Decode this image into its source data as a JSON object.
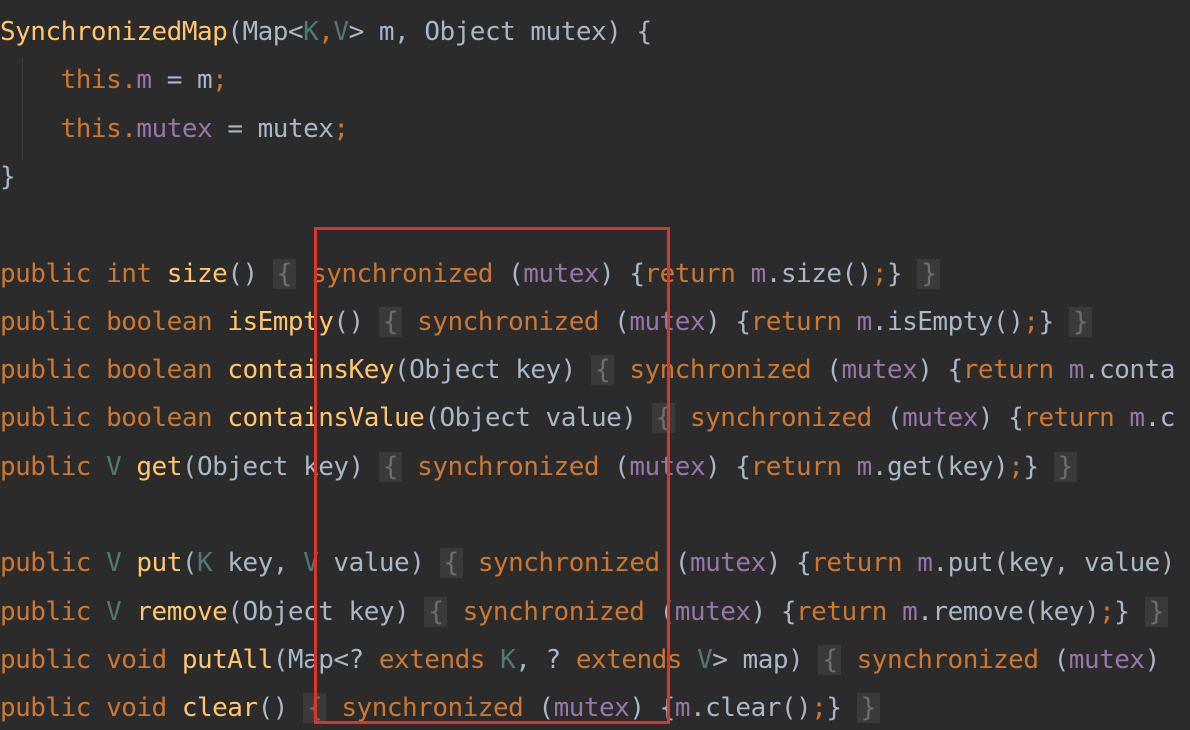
{
  "editor": {
    "theme_colors": {
      "background": "#2b2b2b",
      "keyword": "#cc7832",
      "method": "#ffc66d",
      "field": "#9876aa",
      "type_param": "#507874",
      "plain": "#a9b7c6",
      "highlight_border": "#d9352e"
    },
    "lines": [
      {
        "tokens": [
          {
            "t": "SynchronizedMap",
            "c": "fn"
          },
          {
            "t": "(",
            "c": "pl"
          },
          {
            "t": "Map<",
            "c": "pl"
          },
          {
            "t": "K",
            "c": "tp"
          },
          {
            "t": ",",
            "c": "pu"
          },
          {
            "t": "V",
            "c": "tp"
          },
          {
            "t": "> m, Object mutex) {",
            "c": "pl"
          }
        ]
      },
      {
        "tokens": [
          {
            "t": "    this",
            "c": "kw"
          },
          {
            "t": ".",
            "c": "pu"
          },
          {
            "t": "m",
            "c": "fld"
          },
          {
            "t": " = m",
            "c": "pl"
          },
          {
            "t": ";",
            "c": "pu"
          }
        ]
      },
      {
        "tokens": [
          {
            "t": "    this",
            "c": "kw"
          },
          {
            "t": ".",
            "c": "pu"
          },
          {
            "t": "mutex",
            "c": "fld"
          },
          {
            "t": " = mutex",
            "c": "pl"
          },
          {
            "t": ";",
            "c": "pu"
          }
        ]
      },
      {
        "tokens": [
          {
            "t": "}",
            "c": "pl"
          }
        ]
      },
      {
        "tokens": []
      },
      {
        "tokens": [
          {
            "t": "public int ",
            "c": "kw"
          },
          {
            "t": "size",
            "c": "fn"
          },
          {
            "t": "() ",
            "c": "pl"
          },
          {
            "t": "{",
            "c": "fold"
          },
          {
            "t": " ",
            "c": "pl"
          },
          {
            "t": "synchronized",
            "c": "kw"
          },
          {
            "t": " (",
            "c": "pl"
          },
          {
            "t": "mutex",
            "c": "fld"
          },
          {
            "t": ") {",
            "c": "pl"
          },
          {
            "t": "return ",
            "c": "kw"
          },
          {
            "t": "m",
            "c": "fld"
          },
          {
            "t": ".size()",
            "c": "pl"
          },
          {
            "t": ";",
            "c": "pu"
          },
          {
            "t": "} ",
            "c": "pl"
          },
          {
            "t": "}",
            "c": "fold"
          }
        ]
      },
      {
        "tokens": [
          {
            "t": "public boolean ",
            "c": "kw"
          },
          {
            "t": "isEmpty",
            "c": "fn"
          },
          {
            "t": "() ",
            "c": "pl"
          },
          {
            "t": "{",
            "c": "fold"
          },
          {
            "t": " ",
            "c": "pl"
          },
          {
            "t": "synchronized",
            "c": "kw"
          },
          {
            "t": " (",
            "c": "pl"
          },
          {
            "t": "mutex",
            "c": "fld"
          },
          {
            "t": ") {",
            "c": "pl"
          },
          {
            "t": "return ",
            "c": "kw"
          },
          {
            "t": "m",
            "c": "fld"
          },
          {
            "t": ".isEmpty()",
            "c": "pl"
          },
          {
            "t": ";",
            "c": "pu"
          },
          {
            "t": "} ",
            "c": "pl"
          },
          {
            "t": "}",
            "c": "fold"
          }
        ]
      },
      {
        "tokens": [
          {
            "t": "public boolean ",
            "c": "kw"
          },
          {
            "t": "containsKey",
            "c": "fn"
          },
          {
            "t": "(Object key) ",
            "c": "pl"
          },
          {
            "t": "{",
            "c": "fold"
          },
          {
            "t": " ",
            "c": "pl"
          },
          {
            "t": "synchronized",
            "c": "kw"
          },
          {
            "t": " (",
            "c": "pl"
          },
          {
            "t": "mutex",
            "c": "fld"
          },
          {
            "t": ") {",
            "c": "pl"
          },
          {
            "t": "return ",
            "c": "kw"
          },
          {
            "t": "m",
            "c": "fld"
          },
          {
            "t": ".conta",
            "c": "pl"
          }
        ]
      },
      {
        "tokens": [
          {
            "t": "public boolean ",
            "c": "kw"
          },
          {
            "t": "containsValue",
            "c": "fn"
          },
          {
            "t": "(Object value) ",
            "c": "pl"
          },
          {
            "t": "{",
            "c": "fold"
          },
          {
            "t": " ",
            "c": "pl"
          },
          {
            "t": "synchronized",
            "c": "kw"
          },
          {
            "t": " (",
            "c": "pl"
          },
          {
            "t": "mutex",
            "c": "fld"
          },
          {
            "t": ") {",
            "c": "pl"
          },
          {
            "t": "return ",
            "c": "kw"
          },
          {
            "t": "m",
            "c": "fld"
          },
          {
            "t": ".c",
            "c": "pl"
          }
        ]
      },
      {
        "tokens": [
          {
            "t": "public ",
            "c": "kw"
          },
          {
            "t": "V ",
            "c": "tp"
          },
          {
            "t": "get",
            "c": "fn"
          },
          {
            "t": "(Object key) ",
            "c": "pl"
          },
          {
            "t": "{",
            "c": "fold"
          },
          {
            "t": " ",
            "c": "pl"
          },
          {
            "t": "synchronized",
            "c": "kw"
          },
          {
            "t": " (",
            "c": "pl"
          },
          {
            "t": "mutex",
            "c": "fld"
          },
          {
            "t": ") {",
            "c": "pl"
          },
          {
            "t": "return ",
            "c": "kw"
          },
          {
            "t": "m",
            "c": "fld"
          },
          {
            "t": ".get(key)",
            "c": "pl"
          },
          {
            "t": ";",
            "c": "pu"
          },
          {
            "t": "} ",
            "c": "pl"
          },
          {
            "t": "}",
            "c": "fold"
          }
        ]
      },
      {
        "tokens": []
      },
      {
        "tokens": [
          {
            "t": "public ",
            "c": "kw"
          },
          {
            "t": "V ",
            "c": "tp"
          },
          {
            "t": "put",
            "c": "fn"
          },
          {
            "t": "(",
            "c": "pl"
          },
          {
            "t": "K ",
            "c": "tp"
          },
          {
            "t": "key, ",
            "c": "pl"
          },
          {
            "t": "V ",
            "c": "tp"
          },
          {
            "t": "value) ",
            "c": "pl"
          },
          {
            "t": "{",
            "c": "fold"
          },
          {
            "t": " ",
            "c": "pl"
          },
          {
            "t": "synchronized",
            "c": "kw"
          },
          {
            "t": " (",
            "c": "pl"
          },
          {
            "t": "mutex",
            "c": "fld"
          },
          {
            "t": ") {",
            "c": "pl"
          },
          {
            "t": "return ",
            "c": "kw"
          },
          {
            "t": "m",
            "c": "fld"
          },
          {
            "t": ".put(key, value)",
            "c": "pl"
          }
        ]
      },
      {
        "tokens": [
          {
            "t": "public ",
            "c": "kw"
          },
          {
            "t": "V ",
            "c": "tp"
          },
          {
            "t": "remove",
            "c": "fn"
          },
          {
            "t": "(Object key) ",
            "c": "pl"
          },
          {
            "t": "{",
            "c": "fold"
          },
          {
            "t": " ",
            "c": "pl"
          },
          {
            "t": "synchronized",
            "c": "kw"
          },
          {
            "t": " (",
            "c": "pl"
          },
          {
            "t": "mutex",
            "c": "fld"
          },
          {
            "t": ") {",
            "c": "pl"
          },
          {
            "t": "return ",
            "c": "kw"
          },
          {
            "t": "m",
            "c": "fld"
          },
          {
            "t": ".remove(key)",
            "c": "pl"
          },
          {
            "t": ";",
            "c": "pu"
          },
          {
            "t": "} ",
            "c": "pl"
          },
          {
            "t": "}",
            "c": "fold"
          }
        ]
      },
      {
        "tokens": [
          {
            "t": "public void ",
            "c": "kw"
          },
          {
            "t": "putAll",
            "c": "fn"
          },
          {
            "t": "(Map<? ",
            "c": "pl"
          },
          {
            "t": "extends ",
            "c": "kw"
          },
          {
            "t": "K",
            "c": "tp"
          },
          {
            "t": ", ? ",
            "c": "pl"
          },
          {
            "t": "extends ",
            "c": "kw"
          },
          {
            "t": "V",
            "c": "tp"
          },
          {
            "t": "> map) ",
            "c": "pl"
          },
          {
            "t": "{",
            "c": "fold"
          },
          {
            "t": " ",
            "c": "pl"
          },
          {
            "t": "synchronized",
            "c": "kw"
          },
          {
            "t": " (",
            "c": "pl"
          },
          {
            "t": "mutex",
            "c": "fld"
          },
          {
            "t": ")",
            "c": "pl"
          }
        ]
      },
      {
        "tokens": [
          {
            "t": "public void ",
            "c": "kw"
          },
          {
            "t": "clear",
            "c": "fn"
          },
          {
            "t": "() ",
            "c": "pl"
          },
          {
            "t": "{",
            "c": "fold"
          },
          {
            "t": " ",
            "c": "pl"
          },
          {
            "t": "synchronized",
            "c": "kw"
          },
          {
            "t": " (",
            "c": "pl"
          },
          {
            "t": "mutex",
            "c": "fld"
          },
          {
            "t": ") {",
            "c": "pl"
          },
          {
            "t": "m",
            "c": "fld"
          },
          {
            "t": ".clear()",
            "c": "pl"
          },
          {
            "t": ";",
            "c": "pu"
          },
          {
            "t": "} ",
            "c": "pl"
          },
          {
            "t": "}",
            "c": "fold"
          }
        ]
      }
    ]
  }
}
